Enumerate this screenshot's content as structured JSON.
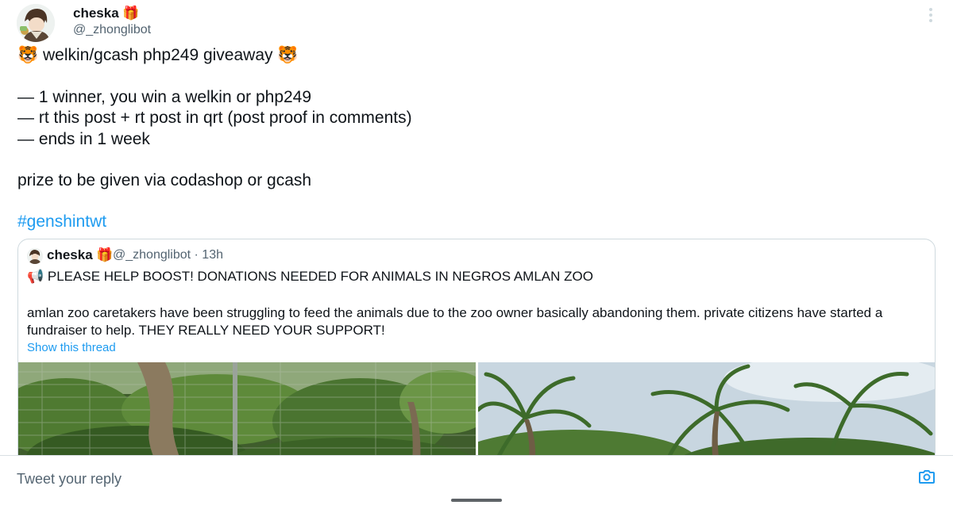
{
  "author": {
    "display_name": "cheska 🎁",
    "handle": "@_zhonglibot"
  },
  "tweet": {
    "lines": [
      "🐯 welkin/gcash php249 giveaway 🐯",
      "",
      "— 1 winner, you win a welkin or php249",
      "— rt this post + rt post in qrt (post proof in comments)",
      "— ends in 1 week",
      "",
      "prize to be given via codashop or gcash"
    ],
    "hashtag": "#genshintwt"
  },
  "quoted": {
    "display_name": "cheska 🎁",
    "handle_time": "@_zhonglibot · 13h",
    "headline": "📢 PLEASE HELP BOOST! DONATIONS NEEDED FOR ANIMALS IN NEGROS AMLAN ZOO",
    "body": "amlan zoo caretakers have been struggling to feed the animals due to the zoo owner basically abandoning them. private citizens have started a fundraiser to help. THEY REALLY NEED YOUR SUPPORT!",
    "show_thread": "Show this thread"
  },
  "reply": {
    "placeholder": "Tweet your reply"
  },
  "icons": {
    "more": "more-vertical-icon",
    "camera": "camera-icon"
  },
  "colors": {
    "link": "#1d9bf0",
    "secondary_text": "#536471",
    "card_border": "#cfd9de"
  }
}
